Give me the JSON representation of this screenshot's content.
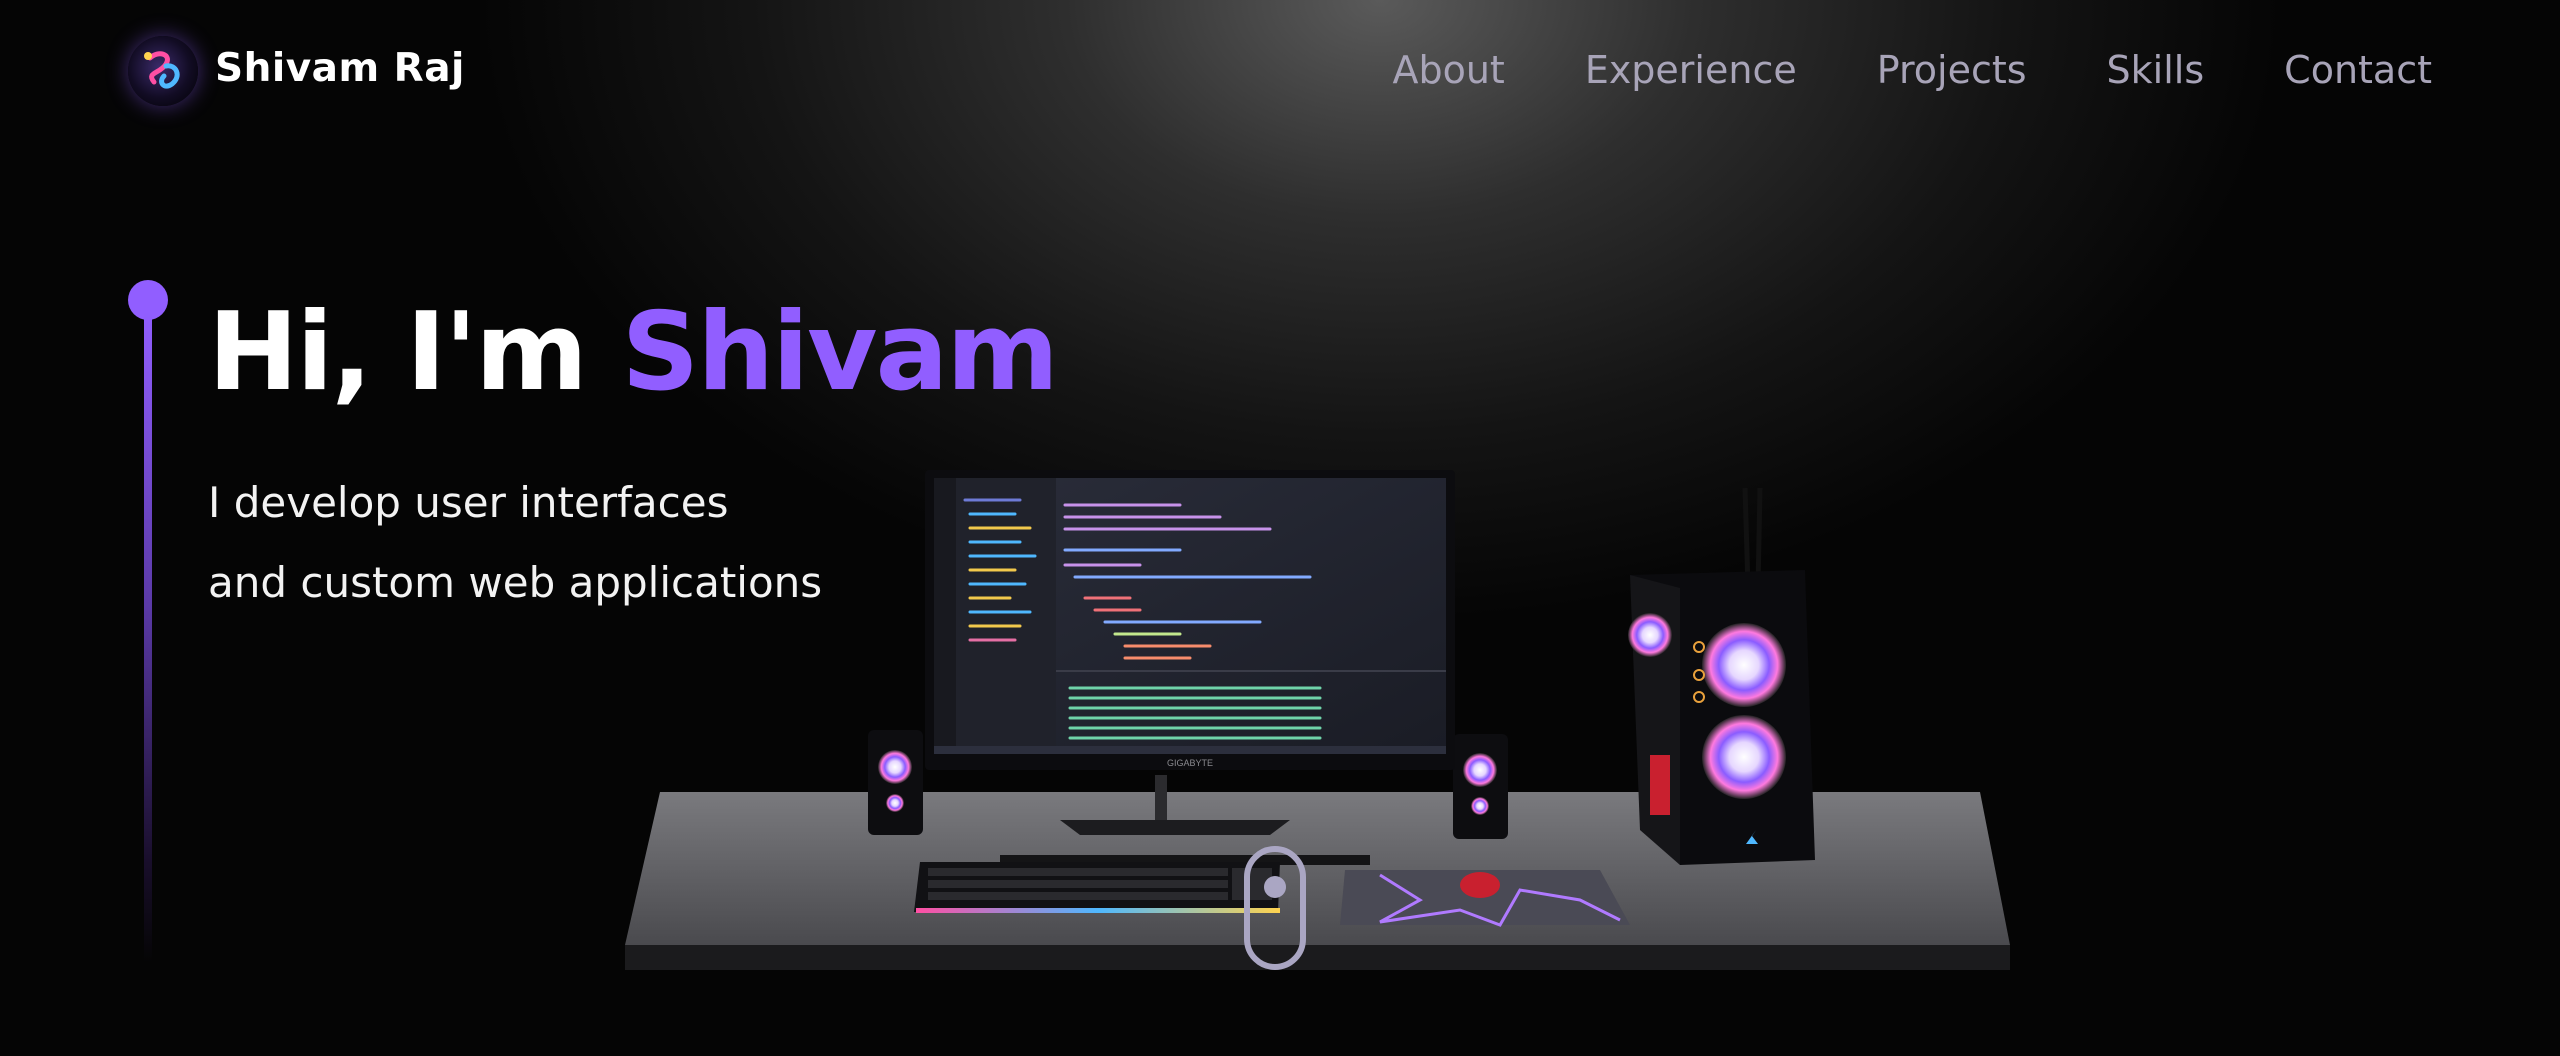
{
  "brand": {
    "name": "Shivam Raj",
    "logo_icon": "gradient-orb-logo-icon"
  },
  "nav": {
    "items": [
      {
        "label": "About"
      },
      {
        "label": "Experience"
      },
      {
        "label": "Projects"
      },
      {
        "label": "Skills"
      },
      {
        "label": "Contact"
      }
    ]
  },
  "hero": {
    "greeting": "Hi, I'm",
    "name": "Shivam",
    "subtitle_line1": "I develop user interfaces",
    "subtitle_line2": "and custom web applications"
  },
  "colors": {
    "accent": "#915eff",
    "nav_text": "#a8a4b8",
    "background": "#050505",
    "indicator": "#aaa6c3"
  },
  "scene": {
    "monitor_brand": "GIGABYTE"
  },
  "scroll_indicator": {
    "icon": "mouse-scroll-icon"
  }
}
